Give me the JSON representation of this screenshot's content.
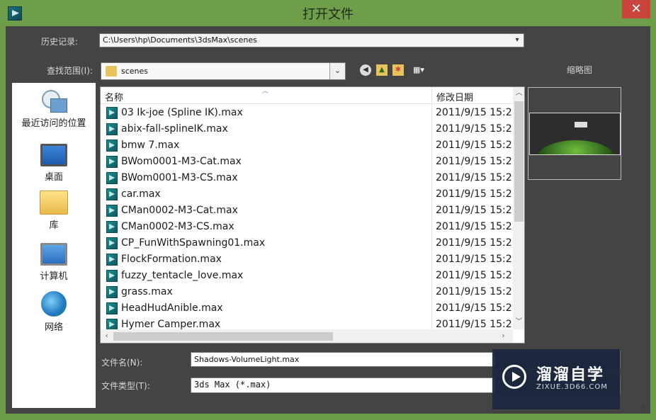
{
  "window": {
    "title": "打开文件",
    "close_glyph": "✕",
    "accent_color": "#6c9c48",
    "close_color": "#c9443d"
  },
  "history": {
    "label": "历史记录:",
    "value": "C:\\Users\\hp\\Documents\\3dsMax\\scenes"
  },
  "lookin": {
    "label": "查找范围(I):",
    "value": "scenes"
  },
  "toolbar": {
    "icons": [
      "back-icon",
      "up-folder-icon",
      "new-folder-icon",
      "view-menu-icon"
    ]
  },
  "places": [
    {
      "label": "最近访问的位置",
      "icon": "recent-places-icon"
    },
    {
      "label": "桌面",
      "icon": "desktop-icon"
    },
    {
      "label": "库",
      "icon": "library-icon"
    },
    {
      "label": "计算机",
      "icon": "computer-icon"
    },
    {
      "label": "网络",
      "icon": "network-icon"
    }
  ],
  "filelist": {
    "columns": {
      "name": "名称",
      "date": "修改日期"
    },
    "rows": [
      {
        "name": "03 Ik-joe (Spline IK).max",
        "date": "2011/9/15 15:2"
      },
      {
        "name": "abix-fall-splineIK.max",
        "date": "2011/9/15 15:2"
      },
      {
        "name": "bmw 7.max",
        "date": "2011/9/15 15:2"
      },
      {
        "name": "BWom0001-M3-Cat.max",
        "date": "2011/9/15 15:2"
      },
      {
        "name": "BWom0001-M3-CS.max",
        "date": "2011/9/15 15:2"
      },
      {
        "name": "car.max",
        "date": "2011/9/15 15:2"
      },
      {
        "name": "CMan0002-M3-Cat.max",
        "date": "2011/9/15 15:2"
      },
      {
        "name": "CMan0002-M3-CS.max",
        "date": "2011/9/15 15:2"
      },
      {
        "name": "CP_FunWithSpawning01.max",
        "date": "2011/9/15 15:2"
      },
      {
        "name": "FlockFormation.max",
        "date": "2011/9/15 15:2"
      },
      {
        "name": "fuzzy_tentacle_love.max",
        "date": "2011/9/15 15:2"
      },
      {
        "name": "grass.max",
        "date": "2011/9/15 15:2"
      },
      {
        "name": "HeadHudAnible.max",
        "date": "2011/9/15 15:2"
      },
      {
        "name": "Hymer Camper.max",
        "date": "2011/9/15 15:2"
      }
    ]
  },
  "thumbnail": {
    "label": "缩略图"
  },
  "filename": {
    "label": "文件名(N):",
    "value": "Shadows-VolumeLight.max"
  },
  "filetype": {
    "label": "文件类型(T):",
    "value": "3ds Max (*.max)"
  },
  "watermark": {
    "title": "溜溜自学",
    "subtitle": "ZIXUE.3D66.COM"
  }
}
